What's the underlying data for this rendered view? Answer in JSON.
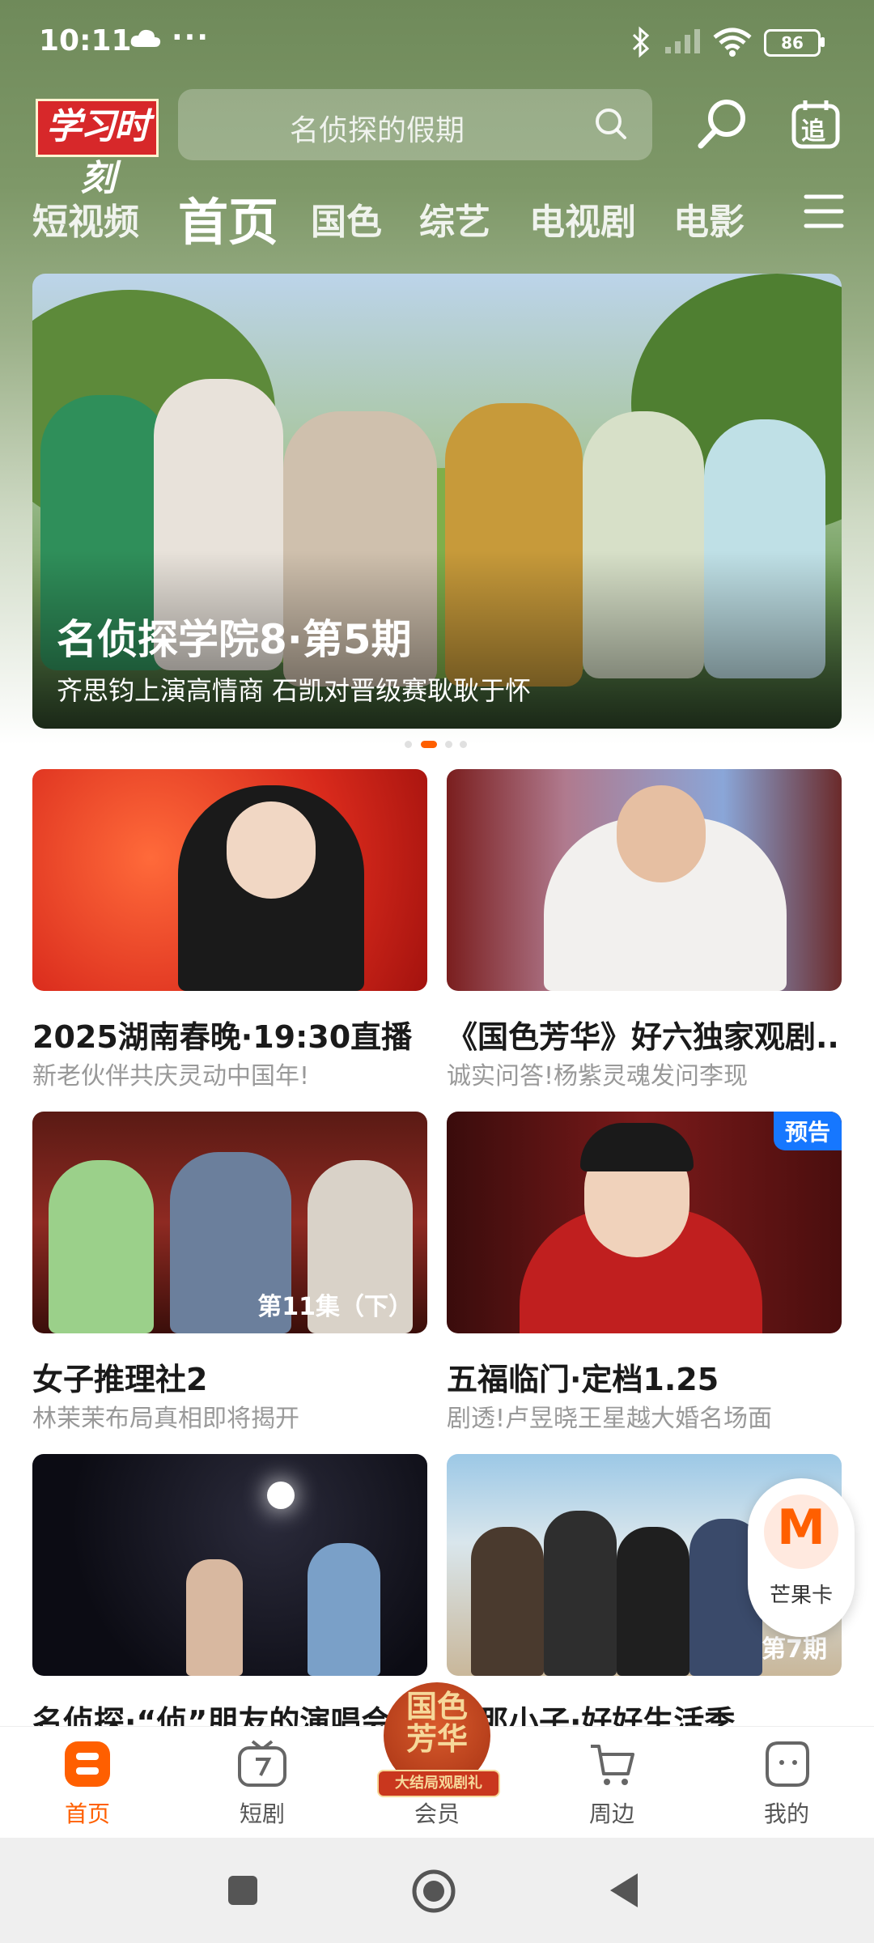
{
  "status_bar": {
    "time": "10:11",
    "more": "···",
    "battery": "86"
  },
  "header": {
    "logo_text": "学习时刻",
    "search_placeholder": "名侦探的假期",
    "follow_label": "追"
  },
  "tabs": [
    {
      "label": "短视频"
    },
    {
      "label": "首页",
      "active": true
    },
    {
      "label": "国色"
    },
    {
      "label": "综艺"
    },
    {
      "label": "电视剧"
    },
    {
      "label": "电影"
    }
  ],
  "banner": {
    "title": "名侦探学院8·第5期",
    "subtitle": "齐思钧上演高情商 石凯对晋级赛耿耿于怀",
    "page_count": 4,
    "active_page": 2
  },
  "cards": [
    {
      "title": "2025湖南春晚·19:30直播",
      "subtitle": "新老伙伴共庆灵动中国年!",
      "episode": "",
      "badge": ""
    },
    {
      "title": "《国色芳华》好六独家观剧...",
      "subtitle": "诚实问答!杨紫灵魂发问李现",
      "episode": "",
      "badge": ""
    },
    {
      "title": "女子推理社2",
      "subtitle": "林茉茉布局真相即将揭开",
      "episode": "第11集（下）",
      "badge": ""
    },
    {
      "title": "五福临门·定档1.25",
      "subtitle": "剧透!卢昱晓王星越大婚名场面",
      "episode": "",
      "badge": "预告"
    },
    {
      "title": "名侦探·“侦”朋友的演唱会",
      "subtitle": "",
      "episode": "",
      "badge": ""
    },
    {
      "title": "家那小子·好好生活季",
      "subtitle": "",
      "episode": "第7期",
      "badge": ""
    }
  ],
  "floating": {
    "label": "芒果卡",
    "mark": "M"
  },
  "bottom_nav": [
    {
      "label": "首页",
      "active": true
    },
    {
      "label": "短剧"
    },
    {
      "label": "会员"
    },
    {
      "label": "周边"
    },
    {
      "label": "我的"
    }
  ],
  "vip_badge": {
    "text_top": "国色",
    "text_bottom": "芳华",
    "ribbon": "大结局观剧礼"
  },
  "colors": {
    "accent": "#ff5f00",
    "badge_blue": "#1677ff"
  }
}
